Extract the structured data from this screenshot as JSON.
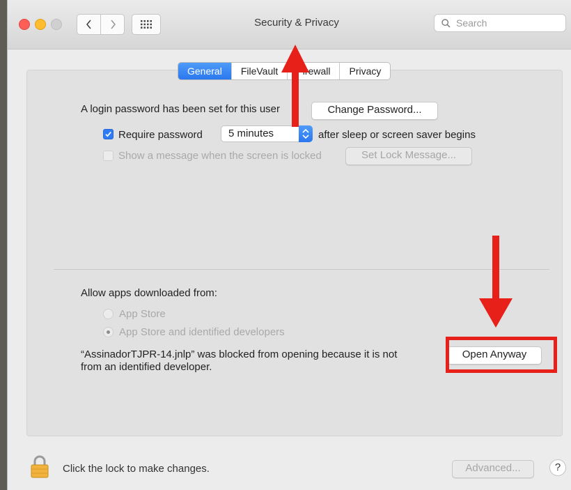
{
  "window": {
    "title": "Security & Privacy",
    "search_placeholder": "Search"
  },
  "tabs": [
    {
      "label": "General",
      "active": true
    },
    {
      "label": "FileVault",
      "active": false
    },
    {
      "label": "Firewall",
      "active": false
    },
    {
      "label": "Privacy",
      "active": false
    }
  ],
  "general": {
    "login_text": "A login password has been set for this user",
    "change_password_label": "Change Password...",
    "require_password_label": "Require password",
    "require_password_checked": true,
    "require_password_option": "5 minutes",
    "after_sleep_text": "after sleep or screen saver begins",
    "show_message_label": "Show a message when the screen is locked",
    "show_message_checked": false,
    "set_lock_message_label": "Set Lock Message..."
  },
  "allow_apps": {
    "heading": "Allow apps downloaded from:",
    "options": [
      {
        "label": "App Store",
        "selected": false
      },
      {
        "label": "App Store and identified developers",
        "selected": true
      }
    ],
    "blocked_line1": "“AssinadorTJPR-14.jnlp” was blocked from opening because it is not",
    "blocked_line2": "from an identified developer.",
    "open_anyway_label": "Open Anyway"
  },
  "footer": {
    "lock_text": "Click the lock to make changes.",
    "advanced_label": "Advanced...",
    "help_label": "?"
  },
  "colors": {
    "accent": "#2f7bf5",
    "annotation_red": "#e8201a"
  },
  "icons": [
    "back-icon",
    "forward-icon",
    "grid-icon",
    "search-icon",
    "lock-icon",
    "checkmark-icon",
    "arrow-up-icon",
    "arrow-down-icon"
  ]
}
